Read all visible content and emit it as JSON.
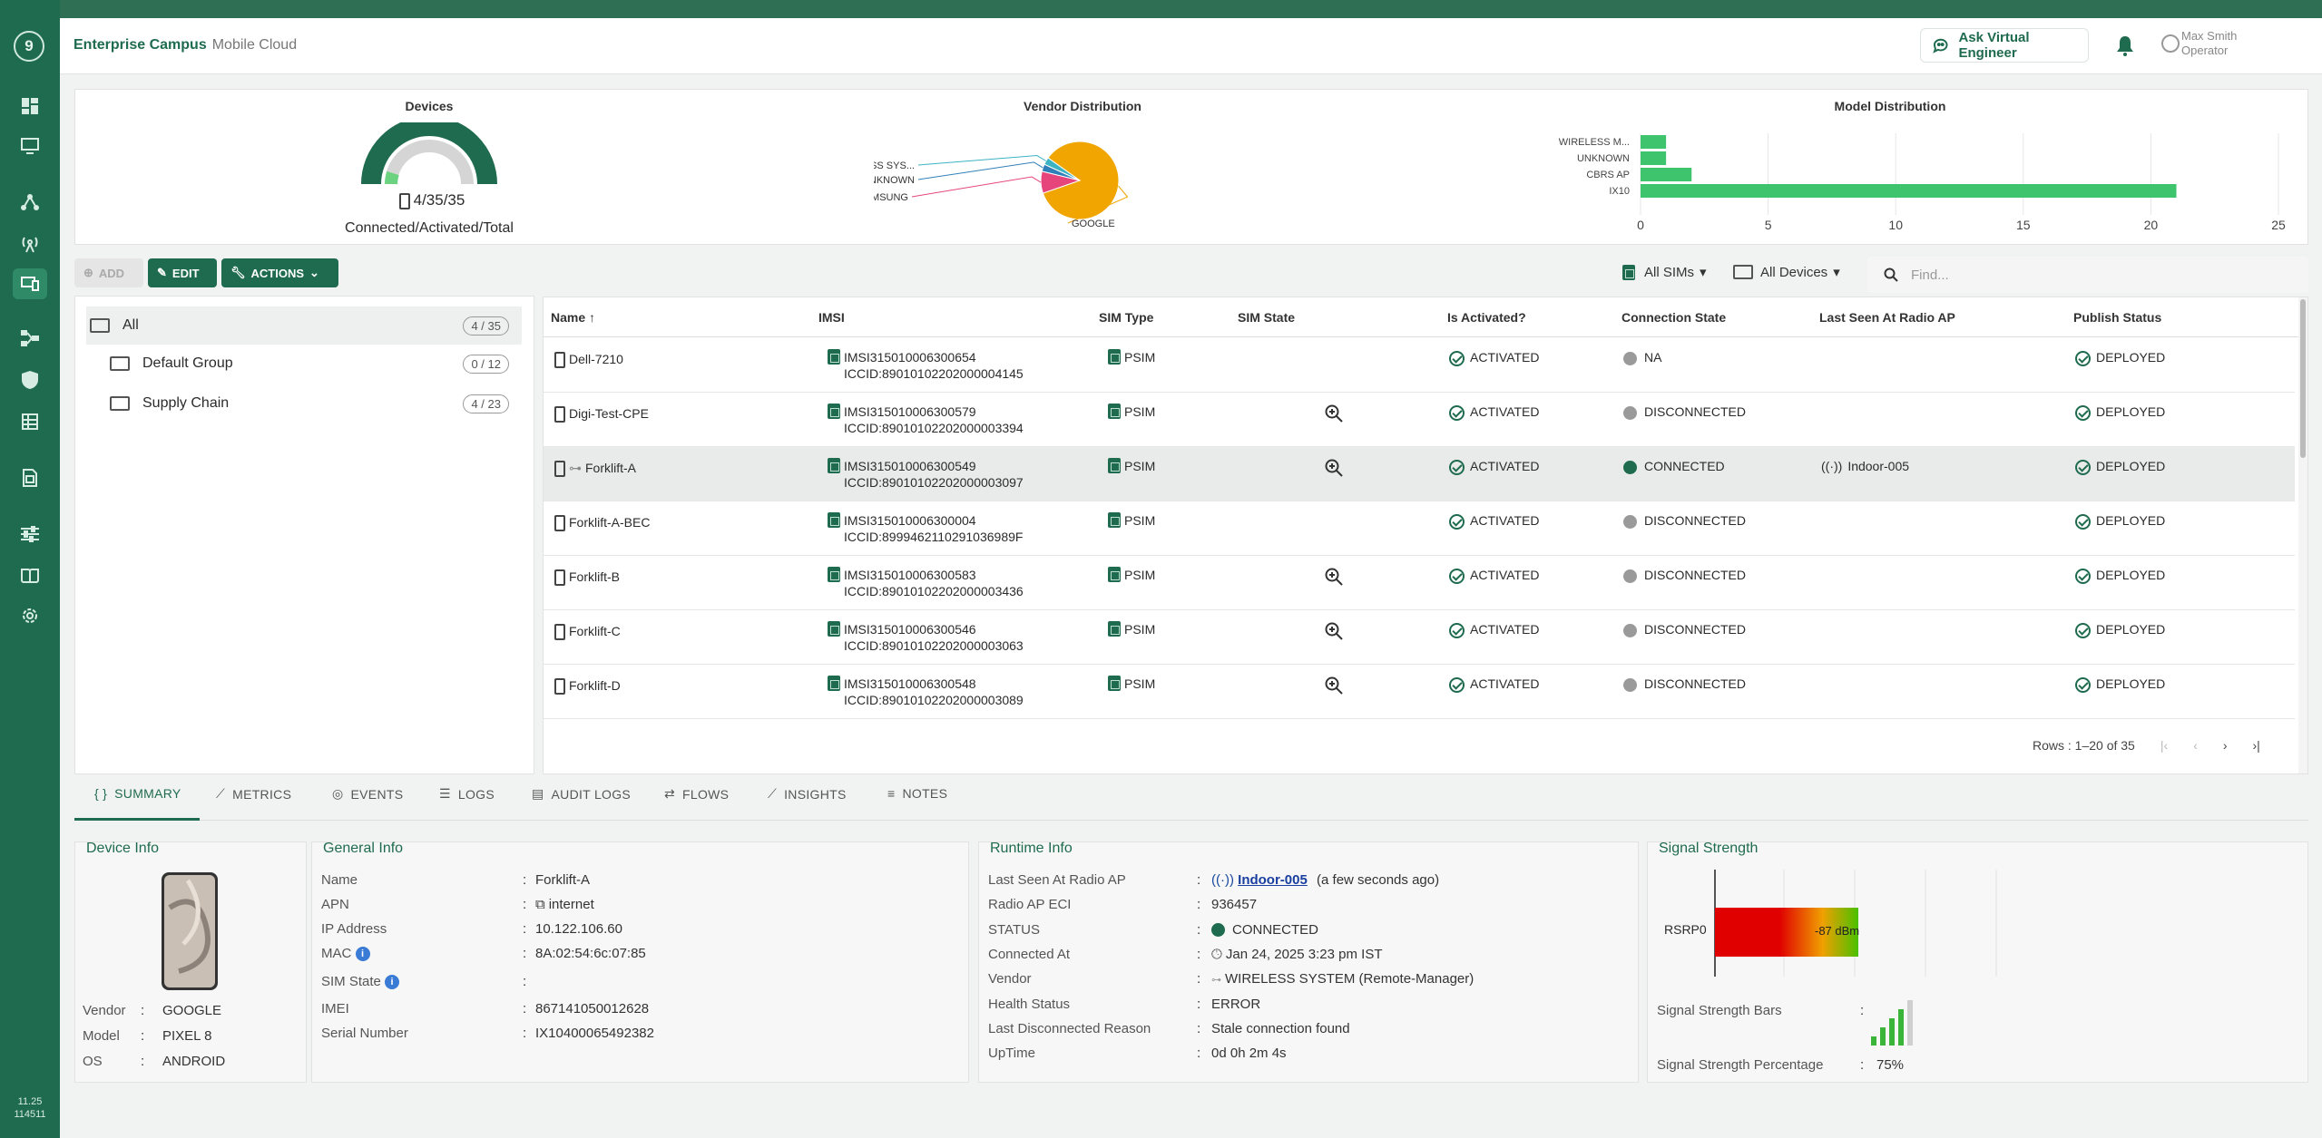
{
  "app": {
    "site": "Enterprise Campus",
    "product": "Mobile Cloud",
    "version": "11.25",
    "build": "114511",
    "logo": "9"
  },
  "header": {
    "ask_label": "Ask Virtual Engineer",
    "user_name": "Max Smith",
    "user_role": "Operator"
  },
  "rail_icons": [
    "dashboard-icon",
    "monitor-icon",
    "topology-icon",
    "radio-tower-icon",
    "devices-icon",
    "network-map-icon",
    "shield-icon",
    "table-icon",
    "sim-icon",
    "sliders-icon",
    "book-icon",
    "settings-icon"
  ],
  "devices_card": {
    "title": "Devices",
    "count": "4/35/35",
    "subtitle": "Connected/Activated/Total",
    "connected": 4,
    "activated": 35,
    "total": 35
  },
  "vendor_card": {
    "title": "Vendor Distribution"
  },
  "model_card": {
    "title": "Model Distribution"
  },
  "chart_data": [
    {
      "type": "pie",
      "title": "Vendor Distribution",
      "labels": [
        "GOOGLE",
        "SAMSUNG",
        "UNKNOWN",
        "WIRELESS SYS..."
      ],
      "values": [
        28,
        3,
        1,
        1
      ],
      "colors": [
        "#f0a500",
        "#e5457a",
        "#2f7fb8",
        "#3bb3c3"
      ]
    },
    {
      "type": "bar",
      "orientation": "horizontal",
      "title": "Model Distribution",
      "categories": [
        "WIRELESS M...",
        "UNKNOWN",
        "CBRS AP",
        "IX10"
      ],
      "values": [
        1,
        1,
        2,
        21
      ],
      "xticks": [
        "0",
        "5",
        "10",
        "15",
        "20",
        "25"
      ],
      "xlim": [
        0,
        25
      ],
      "color": "#3ec46d",
      "grid": true
    }
  ],
  "toolbar": {
    "add": "ADD",
    "edit": "EDIT",
    "actions": "ACTIONS"
  },
  "groups": [
    {
      "name": "All",
      "count": "4 / 35"
    },
    {
      "name": "Default Group",
      "count": "0 / 12"
    },
    {
      "name": "Supply Chain",
      "count": "4 / 23"
    }
  ],
  "filters": {
    "sims": "All SIMs",
    "devices": "All Devices",
    "search_placeholder": "Find..."
  },
  "table": {
    "columns": [
      "Name",
      "IMSI",
      "SIM Type",
      "SIM State",
      "Is Activated?",
      "Connection State",
      "Last Seen At Radio AP",
      "Publish Status"
    ],
    "rows": [
      {
        "name": "Dell-7210",
        "imsi": "IMSI315010006300654",
        "iccid": "ICCID:89010102202000004145",
        "sim_type": "PSIM",
        "activated": "ACTIVATED",
        "conn": "NA",
        "ap": "",
        "publish": "DEPLOYED",
        "zoom": false,
        "connected": false
      },
      {
        "name": "Digi-Test-CPE",
        "imsi": "IMSI315010006300579",
        "iccid": "ICCID:89010102202000003394",
        "sim_type": "PSIM",
        "activated": "ACTIVATED",
        "conn": "DISCONNECTED",
        "ap": "",
        "publish": "DEPLOYED",
        "zoom": true,
        "connected": false
      },
      {
        "name": "Forklift-A",
        "imsi": "IMSI315010006300549",
        "iccid": "ICCID:89010102202000003097",
        "sim_type": "PSIM",
        "activated": "ACTIVATED",
        "conn": "CONNECTED",
        "ap": "Indoor-005",
        "publish": "DEPLOYED",
        "zoom": true,
        "connected": true
      },
      {
        "name": "Forklift-A-BEC",
        "imsi": "IMSI315010006300004",
        "iccid": "ICCID:8999462110291036989F",
        "sim_type": "PSIM",
        "activated": "ACTIVATED",
        "conn": "DISCONNECTED",
        "ap": "",
        "publish": "DEPLOYED",
        "zoom": false,
        "connected": false
      },
      {
        "name": "Forklift-B",
        "imsi": "IMSI315010006300583",
        "iccid": "ICCID:89010102202000003436",
        "sim_type": "PSIM",
        "activated": "ACTIVATED",
        "conn": "DISCONNECTED",
        "ap": "",
        "publish": "DEPLOYED",
        "zoom": true,
        "connected": false
      },
      {
        "name": "Forklift-C",
        "imsi": "IMSI315010006300546",
        "iccid": "ICCID:89010102202000003063",
        "sim_type": "PSIM",
        "activated": "ACTIVATED",
        "conn": "DISCONNECTED",
        "ap": "",
        "publish": "DEPLOYED",
        "zoom": true,
        "connected": false
      },
      {
        "name": "Forklift-D",
        "imsi": "IMSI315010006300548",
        "iccid": "ICCID:89010102202000003089",
        "sim_type": "PSIM",
        "activated": "ACTIVATED",
        "conn": "DISCONNECTED",
        "ap": "",
        "publish": "DEPLOYED",
        "zoom": true,
        "connected": false
      }
    ],
    "pager": "Rows : 1–20 of 35"
  },
  "tabs": [
    "SUMMARY",
    "METRICS",
    "EVENTS",
    "LOGS",
    "AUDIT LOGS",
    "FLOWS",
    "INSIGHTS",
    "NOTES"
  ],
  "device_info": {
    "title": "Device Info",
    "vendor_k": "Vendor",
    "vendor": "GOOGLE",
    "model_k": "Model",
    "model": "PIXEL 8",
    "os_k": "OS",
    "os": "ANDROID"
  },
  "general_info": {
    "title": "General Info",
    "rows": [
      {
        "k": "Name",
        "v": "Forklift-A"
      },
      {
        "k": "APN",
        "v": "internet"
      },
      {
        "k": "IP Address",
        "v": "10.122.106.60"
      },
      {
        "k": "MAC",
        "v": "8A:02:54:6c:07:85"
      },
      {
        "k": "SIM State",
        "v": ""
      },
      {
        "k": "IMEI",
        "v": "867141050012628"
      },
      {
        "k": "Serial Number",
        "v": "IX10400065492382"
      }
    ]
  },
  "runtime_info": {
    "title": "Runtime Info",
    "rows": [
      {
        "k": "Last Seen At Radio AP",
        "v": "Indoor-005",
        "extra": "(a few seconds ago)"
      },
      {
        "k": "Radio AP ECI",
        "v": "936457"
      },
      {
        "k": "STATUS",
        "v": "CONNECTED"
      },
      {
        "k": "Connected At",
        "v": "Jan 24, 2025 3:23 pm IST"
      },
      {
        "k": "Vendor",
        "v": "WIRELESS SYSTEM  (Remote-Manager)"
      },
      {
        "k": "Health Status",
        "v": "ERROR"
      },
      {
        "k": "Last Disconnected Reason",
        "v": "Stale connection found"
      },
      {
        "k": "UpTime",
        "v": "0d 0h 2m 4s"
      }
    ]
  },
  "signal": {
    "title": "Signal Strength",
    "rsrp_label": "RSRP0",
    "rsrp_value": "-87 dBm",
    "bars_label": "Signal Strength Bars",
    "pct_label": "Signal Strength Percentage",
    "pct": "75%",
    "bars_lit": 4,
    "bars_total": 5
  }
}
